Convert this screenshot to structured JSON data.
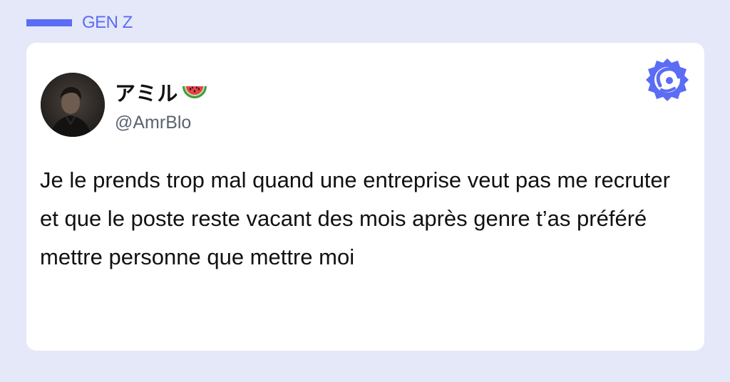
{
  "category": {
    "label": "GEN Z",
    "color": "#5b6cf5"
  },
  "post": {
    "author_name": "アミル",
    "author_emoji": "watermelon-icon",
    "author_handle": "@AmrBlo",
    "text": "Je le prends trop mal quand une entreprise veut pas me recruter et que le poste reste vacant des mois après genre t’as préféré mettre personne que mettre moi"
  },
  "brand": {
    "icon": "brand-logo-icon",
    "color": "#5b6cf5"
  },
  "colors": {
    "background": "#e4e8f8",
    "card": "#ffffff",
    "text": "#111111",
    "handle": "#5a6470"
  }
}
